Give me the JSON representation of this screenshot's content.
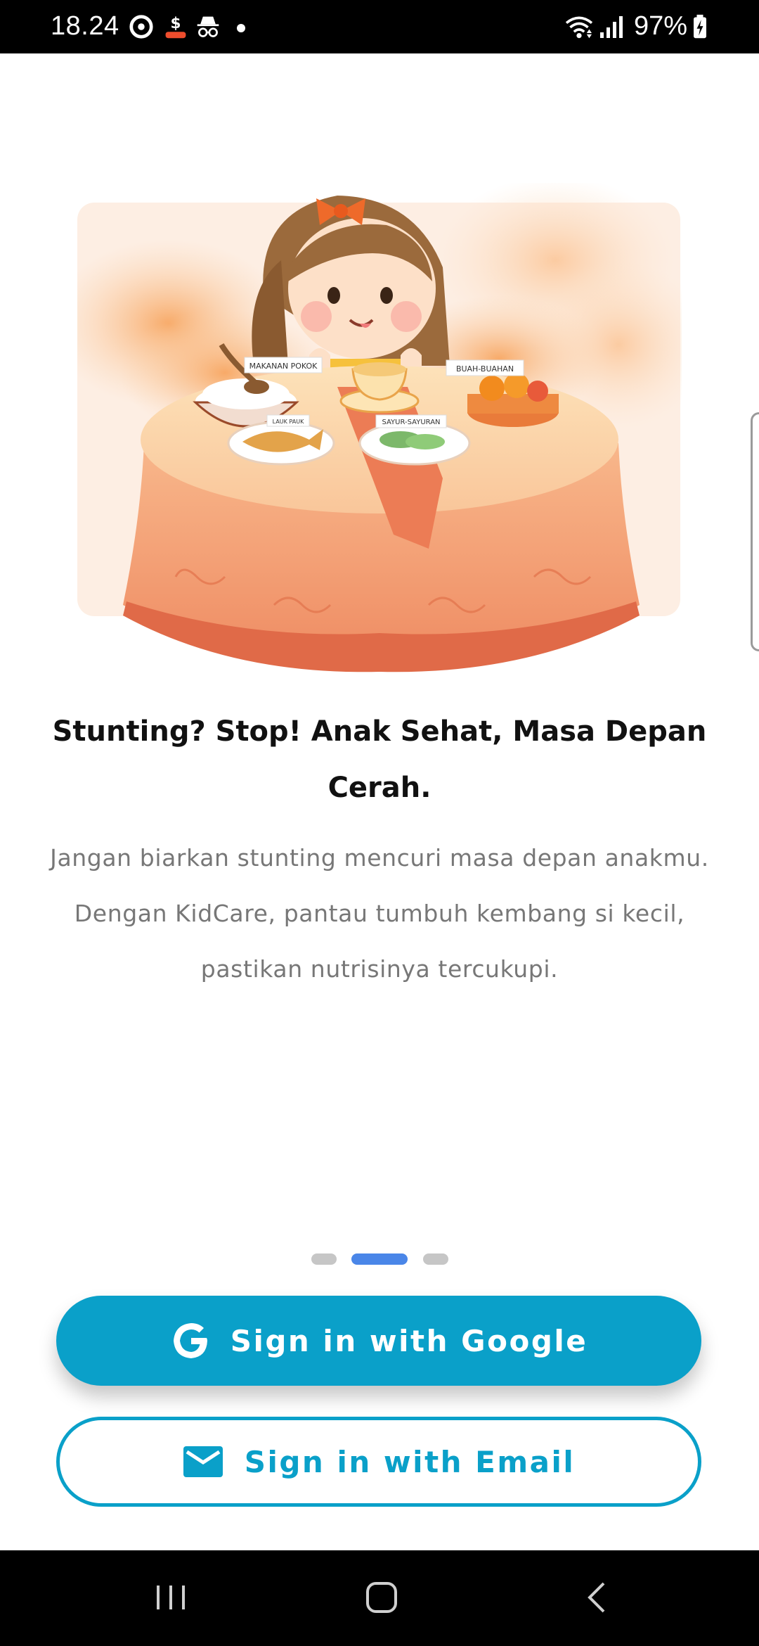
{
  "status_bar": {
    "time": "18.24",
    "battery": "97%"
  },
  "onboarding": {
    "headline": "Stunting? Stop! Anak Sehat, Masa Depan Cerah.",
    "description": "Jangan biarkan stunting mencuri masa depan anakmu. Dengan KidCare, pantau tumbuh kembang si kecil, pastikan nutrisinya tercukupi.",
    "page_index": 2,
    "page_count": 3,
    "illustration_labels": {
      "rice": "MAKANAN POKOK",
      "fruit": "BUAH-BUAHAN",
      "vegetables": "SAYUR-SAYURAN",
      "fish": "LAUK PAUK"
    }
  },
  "buttons": {
    "google_label": "Sign in with Google",
    "email_label": "Sign in with Email"
  },
  "colors": {
    "accent": "#0aa0c9",
    "pager_active": "#4a86e8",
    "pager_inactive": "#c6c6c6"
  }
}
